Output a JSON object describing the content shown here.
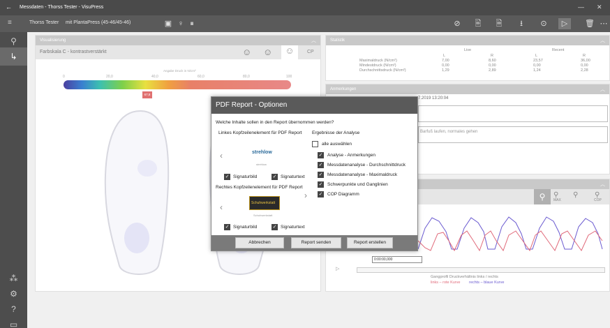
{
  "window": {
    "back_glyph": "←",
    "title": "Messdaten - Thorss Tester - VisuPress",
    "minimize_glyph": "—",
    "close_glyph": "✕"
  },
  "toolbar": {
    "patient": "Thorss Tester",
    "device": "mit PlantaPress (45-46/45-46)",
    "center_icons": [
      "▣",
      "♀",
      "⏸"
    ],
    "right_icons": [
      "⊘",
      "🖹",
      "🗎",
      "⭳",
      "⊙",
      "▷",
      "🗑",
      "⋯"
    ]
  },
  "sidebar": {
    "icons": [
      "⚲",
      "↳",
      "⁂",
      "⚙",
      "?",
      "▭"
    ]
  },
  "visual_panel": {
    "header": "Visualisierung",
    "colorscale": "Farbskala C - kontrastverstärkt",
    "cp_label": "CP",
    "scale_title": "Angabe Druck in N/cm²",
    "ticks": [
      "0",
      "20,0",
      "40,0",
      "60,0",
      "80,0",
      "100"
    ],
    "marker": "67,8"
  },
  "stats_panel": {
    "header": "Statistik",
    "live": "Live",
    "recent": "Recent",
    "L": "L",
    "R": "R",
    "rows": [
      {
        "label": "Maximaldruck (N/cm²)",
        "vals": [
          "7,00",
          "8,60",
          "23,57",
          "36,00"
        ]
      },
      {
        "label": "Mindestdruck (N/cm²)",
        "vals": [
          "0,00",
          "0,00",
          "0,00",
          "0,00"
        ]
      },
      {
        "label": "Durchschnittsdruck (N/cm²)",
        "vals": [
          "1,29",
          "2,89",
          "1,24",
          "2,28"
        ]
      }
    ]
  },
  "notes_panel": {
    "header": "Anmerkungen",
    "timestamp": "7.2019 13:20:04",
    "note": "Barfuß laufen, normales gehen"
  },
  "graph_panel": {
    "time": "0:00:00,000",
    "caption": "Gangprofil Druckverhältnis links / rechts",
    "legend_left": "links – rote Kurve",
    "legend_right": "rechts – blaue Kurve",
    "max_label": "MAX",
    "cop_label": "COP"
  },
  "dialog": {
    "title": "PDF Report - Optionen",
    "question": "Welche Inhalte sollen in den Report übernommen werden?",
    "left_header": "Linkes Kopfzeilenelement für PDF Report",
    "right_header": "Rechtes Kopfzeilenelement für PDF Report",
    "logo1_text": "strehlow",
    "logo1_sub": "strehlow",
    "logo2_text": "Schuhwerkstatt",
    "logo2_sub": "Schuhwerkstatt",
    "sig_image": "Signaturbild",
    "sig_text": "Signaturtext",
    "results_header": "Ergebnisse der Analyse",
    "select_all": "alle auswählen",
    "options": [
      "Analyse - Anmerkungen",
      "Messdatenanalyse - Durchschnittdruck",
      "Messdatenanalyse - Maximaldruck",
      "Schwerpunkte und Ganglinien",
      "COP Diagramm"
    ],
    "btn_cancel": "Abbrechen",
    "btn_send": "Report senden",
    "btn_create": "Report erstellen",
    "prev_glyph": "‹",
    "next_glyph": "›"
  },
  "colors": {
    "accent": "#5a5a5a",
    "left_curve": "#e06a7a",
    "right_curve": "#6a5ad0"
  }
}
